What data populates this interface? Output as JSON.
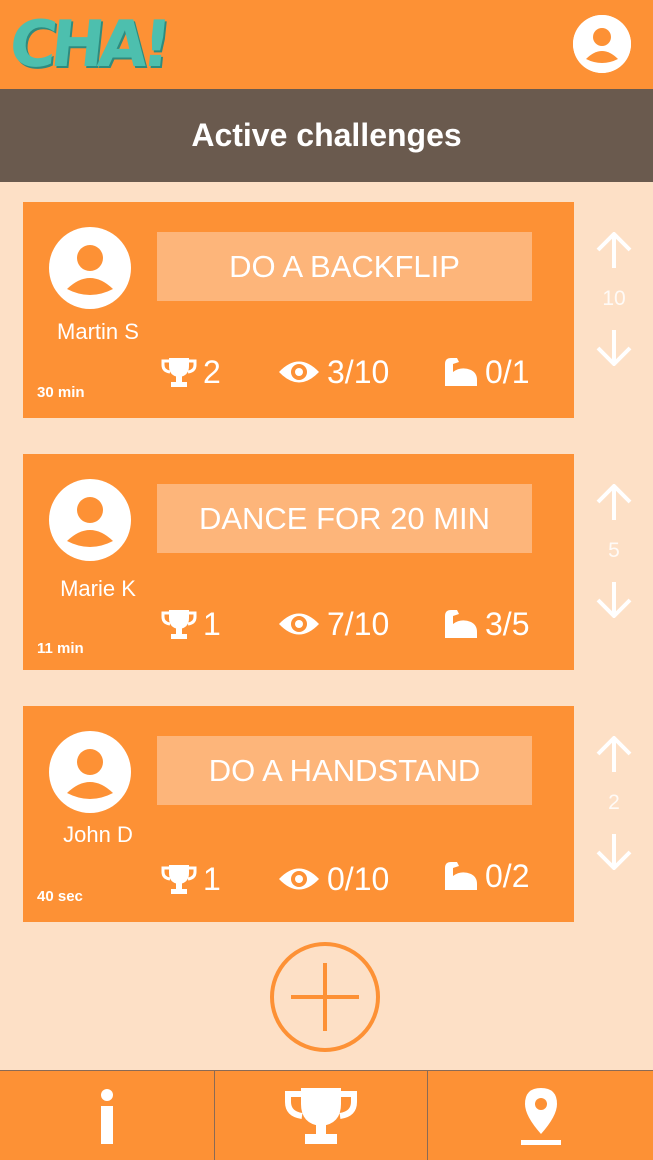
{
  "app": {
    "logo_text": "CHA!",
    "header_title": "Active challenges",
    "icons": {
      "profile": "account-circle-icon",
      "trophy": "trophy-icon",
      "views": "eye-icon",
      "attempts": "flexed-bicep-icon",
      "upvote": "arrow-up-icon",
      "downvote": "arrow-down-icon",
      "add": "add-circle-icon",
      "info": "info-icon",
      "leaderboard": "trophy-icon",
      "location": "location-pin-icon"
    },
    "colors": {
      "primary": "#fd9135",
      "header_bar": "#6a5a4e",
      "background": "#fde0c6",
      "title_box": "#fdb57a",
      "logo": "#4dbfae"
    }
  },
  "challenges": [
    {
      "title": "DO A BACKFLIP",
      "author": "Martin S",
      "time": "30 min",
      "trophies": "2",
      "views": "3/10",
      "attempts": "0/1",
      "votes": "10"
    },
    {
      "title": "DANCE FOR 20 MIN",
      "author": "Marie K",
      "time": "11 min",
      "trophies": "1",
      "views": "7/10",
      "attempts": "3/5",
      "votes": "5"
    },
    {
      "title": "DO A HANDSTAND",
      "author": "John D",
      "time": "40 sec",
      "trophies": "1",
      "views": "0/10",
      "attempts": "0/2",
      "votes": "2"
    }
  ],
  "bottom_nav": {
    "info_label": "i"
  }
}
